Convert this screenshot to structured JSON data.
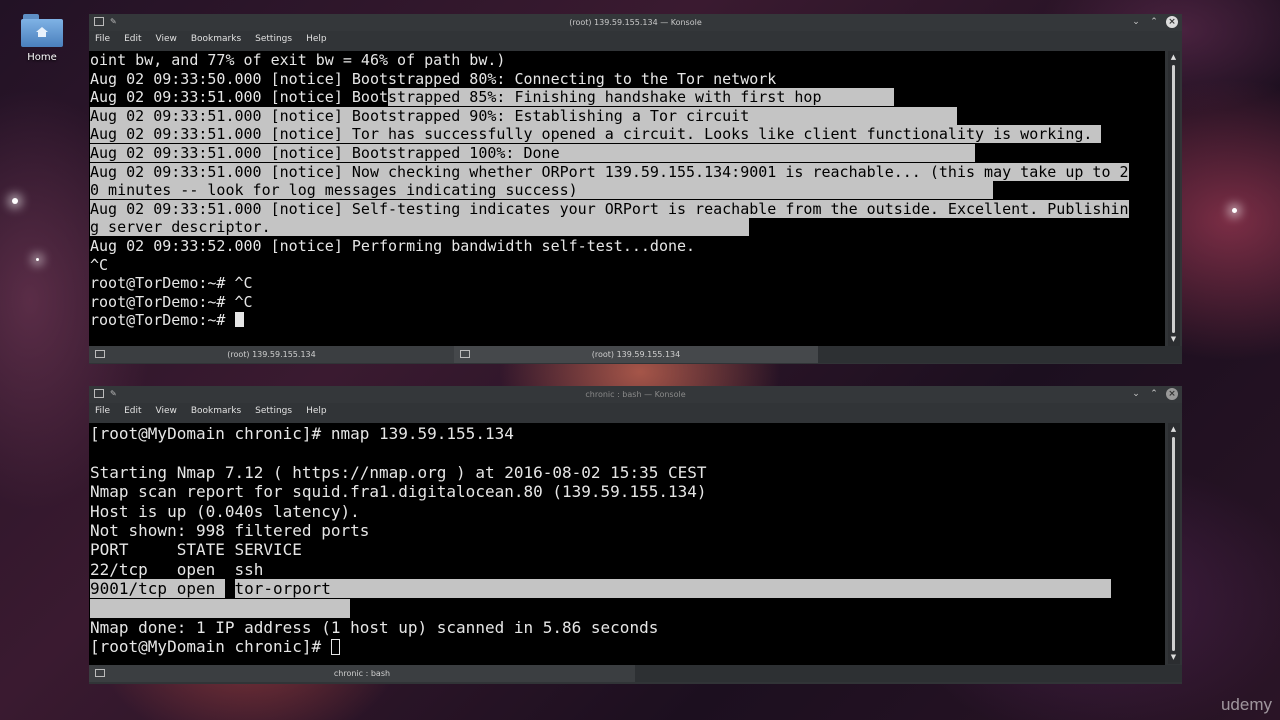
{
  "desktop": {
    "home_label": "Home"
  },
  "menu": [
    "File",
    "Edit",
    "View",
    "Bookmarks",
    "Settings",
    "Help"
  ],
  "window1": {
    "title": "(root) 139.59.155.134 — Konsole",
    "lines": [
      [
        {
          "t": "oint bw, and 77% of exit bw = 46% of path bw.)"
        }
      ],
      [
        {
          "t": "Aug 02 09:33:50.000 [notice] Bootstrapped 80%: Connecting to the Tor network"
        }
      ],
      [
        {
          "t": "Aug 02 09:33:51.000 [notice] Boot"
        },
        {
          "t": "strapped 85%: Finishing handshake with first hop        ",
          "hl": true
        }
      ],
      [
        {
          "t": "Aug 02 09:33:51.000 [notice] Bootstrapped 90%: Establishing a Tor circuit                       ",
          "hl": true
        }
      ],
      [
        {
          "t": "Aug 02 09:33:51.000 [notice] Tor has successfully opened a circuit. Looks like client functionality is working. ",
          "hl": true
        }
      ],
      [
        {
          "t": "Aug 02 09:33:51.000 [notice] Bootstrapped 100%: Done                                              ",
          "hl": true
        }
      ],
      [
        {
          "t": "Aug 02 09:33:51.000 [notice] Now checking whether ORPort 139.59.155.134:9001 is reachable... (this may take up to 2",
          "hl": true
        }
      ],
      [
        {
          "t": "0 minutes -- look for log messages indicating success)                                              ",
          "hl": true
        }
      ],
      [
        {
          "t": "Aug 02 09:33:51.000 [notice] Self-testing indicates your ORPort is reachable from the outside. Excellent. Publishin",
          "hl": true
        }
      ],
      [
        {
          "t": "g server descriptor.",
          "hl": true
        },
        {
          "t": "                                                     ",
          "hl": true
        }
      ],
      [
        {
          "t": "Aug 02 09:33:52.000 [notice] Performing bandwidth self-test...done."
        }
      ],
      [
        {
          "t": "^C"
        }
      ],
      [
        {
          "t": "root@TorDemo:~# ^C"
        }
      ],
      [
        {
          "t": "root@TorDemo:~# ^C"
        }
      ],
      [
        {
          "t": "root@TorDemo:~# "
        }
      ]
    ],
    "tabs": [
      "(root) 139.59.155.134",
      "(root) 139.59.155.134"
    ]
  },
  "window2": {
    "title": "chronic : bash — Konsole",
    "lines": [
      [
        {
          "t": "[root@MyDomain chronic]# nmap 139.59.155.134"
        }
      ],
      [
        {
          "t": ""
        }
      ],
      [
        {
          "t": "Starting Nmap 7.12 ( https://nmap.org ) at 2016-08-02 15:35 CEST"
        }
      ],
      [
        {
          "t": "Nmap scan report for squid.fra1.digitalocean.80 (139.59.155.134)"
        }
      ],
      [
        {
          "t": "Host is up (0.040s latency)."
        }
      ],
      [
        {
          "t": "Not shown: 998 filtered ports"
        }
      ],
      [
        {
          "t": "PORT     STATE SERVICE"
        }
      ],
      [
        {
          "t": "22/tcp   open  ssh"
        }
      ],
      [
        {
          "t": "9001/tcp open ",
          "hl": true
        },
        {
          "t": " "
        },
        {
          "t": "tor-orport                                                                                 ",
          "hl": true
        }
      ],
      [
        {
          "t": "                           ",
          "hl": true
        }
      ],
      [
        {
          "t": "Nmap done: 1 IP address (1 host up) scanned in 5.86 seconds"
        }
      ],
      [
        {
          "t": "[root@MyDomain chronic]# "
        }
      ]
    ],
    "tabs": [
      "chronic : bash"
    ]
  },
  "watermark": "udemy"
}
